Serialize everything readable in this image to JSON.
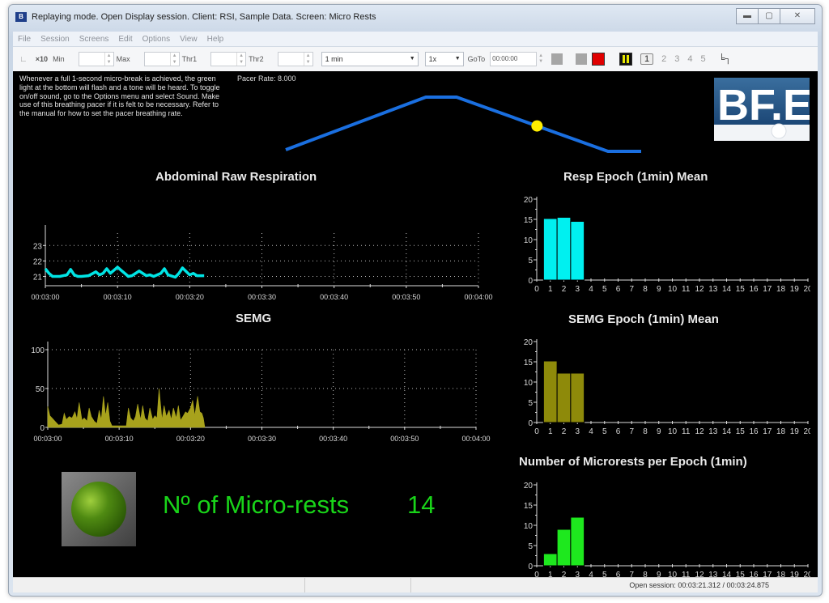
{
  "window": {
    "title": "Replaying mode. Open Display session. Client: RSI, Sample Data. Screen: Micro Rests",
    "controls": [
      "minimize",
      "maximize",
      "close"
    ]
  },
  "menu": [
    "File",
    "Session",
    "Screens",
    "Edit",
    "Options",
    "View",
    "Help"
  ],
  "toolbar": {
    "scale_label": "×10",
    "min_label": "Min",
    "min_value": "",
    "max_label": "Max",
    "max_value": "",
    "thr1_label": "Thr1",
    "thr1_value": "",
    "thr2_label": "Thr2",
    "thr2_value": "",
    "epoch_select": "1 min",
    "speed_select": "1x",
    "goto_label": "GoTo",
    "goto_value": "00:00:00",
    "pages": [
      "1",
      "2",
      "3",
      "4",
      "5"
    ],
    "active_page": "1",
    "colors": {
      "gray": "#a6a6a6",
      "stop": "#e00000",
      "pause": "#e8e800"
    }
  },
  "info_text": "Whenever a full 1-second micro-break is achieved, the green light at the bottom will flash and a tone will be heard. To toggle on/off sound, go to the Options menu and select Sound. Make use of this breathing pacer if it is felt to be necessary. Refer to the manual for how to set the pacer breathing rate.",
  "pacer": {
    "label": "Pacer Rate: 8.000",
    "line_color": "#1a6fe0",
    "marker_color": "#ffee00",
    "progress": 0.71
  },
  "logo": {
    "text": "BF.E"
  },
  "microrests": {
    "label": "Nº of Micro-rests",
    "count": "14",
    "color": "#19d419"
  },
  "status": {
    "session": "Open session: 00:03:21.312 / 00:03:24.875"
  },
  "chart_data": [
    {
      "id": "respiration",
      "type": "line",
      "title": "Abdominal Raw Respiration",
      "color": "#00e5e5",
      "ylim": [
        20.4,
        23.8
      ],
      "yticks": [
        21,
        22,
        23
      ],
      "xlim": [
        180,
        240
      ],
      "xticks": [
        "00:03:00",
        "00:03:10",
        "00:03:20",
        "00:03:30",
        "00:03:40",
        "00:03:50",
        "00:04:00"
      ],
      "grid": true,
      "x": [
        180,
        180.5,
        181,
        182,
        183,
        183.5,
        184,
        184.5,
        185,
        186,
        187,
        187.5,
        188,
        188.5,
        189,
        189.5,
        190,
        190.5,
        191,
        191.5,
        192,
        193,
        194,
        194.5,
        195,
        196,
        196.5,
        197,
        198,
        198.5,
        199,
        200,
        200.5,
        201,
        201.5,
        202
      ],
      "y": [
        21.5,
        21.2,
        21.0,
        21.0,
        21.1,
        21.45,
        21.1,
        21.0,
        21.0,
        21.05,
        21.3,
        21.1,
        21.2,
        21.5,
        21.2,
        21.4,
        21.6,
        21.4,
        21.2,
        21.0,
        21.05,
        21.35,
        21.05,
        21.1,
        21.0,
        21.2,
        21.5,
        21.1,
        20.95,
        21.2,
        21.55,
        21.1,
        21.2,
        21.05,
        21.05,
        21.05
      ]
    },
    {
      "id": "semg",
      "type": "area",
      "title": "SEMG",
      "color": "#a8a21c",
      "ylim": [
        0,
        100
      ],
      "yticks": [
        0,
        50,
        100
      ],
      "xlim": [
        180,
        240
      ],
      "xticks": [
        "00:03:00",
        "00:03:10",
        "00:03:20",
        "00:03:30",
        "00:03:40",
        "00:03:50",
        "00:04:00"
      ],
      "grid": true,
      "x": [
        180,
        180.3,
        180.6,
        181,
        181.5,
        182,
        182.3,
        182.6,
        183,
        183.4,
        183.8,
        184.1,
        184.4,
        184.8,
        185.1,
        185.5,
        185.8,
        186.1,
        186.5,
        186.9,
        187.2,
        187.5,
        187.8,
        188.1,
        188.4,
        188.7,
        189,
        189.5,
        190,
        190.5,
        191,
        191.3,
        191.6,
        192,
        192.3,
        192.6,
        193,
        193.3,
        193.6,
        194,
        194.3,
        194.7,
        195,
        195.3,
        195.6,
        196,
        196.3,
        196.6,
        197,
        197.3,
        197.6,
        198,
        198.3,
        198.6,
        199,
        199.3,
        199.6,
        200,
        200.3,
        200.6,
        201,
        201.3,
        201.6,
        201.8,
        202
      ],
      "y": [
        27,
        15,
        12,
        8,
        3,
        4,
        18,
        10,
        14,
        12,
        20,
        11,
        32,
        9,
        12,
        8,
        25,
        14,
        8,
        5,
        22,
        10,
        40,
        15,
        32,
        8,
        2,
        2,
        2,
        2,
        2,
        25,
        12,
        8,
        14,
        30,
        10,
        28,
        12,
        8,
        25,
        10,
        15,
        12,
        50,
        10,
        28,
        14,
        22,
        10,
        25,
        12,
        28,
        9,
        15,
        20,
        18,
        25,
        35,
        15,
        40,
        20,
        18,
        12,
        0
      ]
    },
    {
      "id": "resp-epoch",
      "type": "bar",
      "title": "Resp Epoch (1min) Mean",
      "color": "#00f0f0",
      "categories": [
        "1",
        "2",
        "3"
      ],
      "values": [
        15.2,
        15.5,
        14.5
      ],
      "ylim": [
        0,
        20
      ],
      "yticks": [
        0,
        5,
        10,
        15,
        20
      ],
      "xlim": [
        0,
        20
      ],
      "xticks": [
        "0",
        "1",
        "2",
        "3",
        "4",
        "5",
        "6",
        "7",
        "8",
        "9",
        "10",
        "11",
        "12",
        "13",
        "14",
        "15",
        "16",
        "17",
        "18",
        "19",
        "20"
      ]
    },
    {
      "id": "semg-epoch",
      "type": "bar",
      "title": "SEMG Epoch (1min) Mean",
      "color": "#8e8a0a",
      "categories": [
        "1",
        "2",
        "3"
      ],
      "values": [
        15.2,
        12.2,
        12.2
      ],
      "ylim": [
        0,
        20
      ],
      "yticks": [
        0,
        5,
        10,
        15,
        20
      ],
      "xlim": [
        0,
        20
      ],
      "xticks": [
        "0",
        "1",
        "2",
        "3",
        "4",
        "5",
        "6",
        "7",
        "8",
        "9",
        "10",
        "11",
        "12",
        "13",
        "14",
        "15",
        "16",
        "17",
        "18",
        "19",
        "20"
      ]
    },
    {
      "id": "microrests-epoch",
      "type": "bar",
      "title": "Number of Microrests per Epoch (1min)",
      "color": "#1ee81e",
      "categories": [
        "1",
        "2",
        "3"
      ],
      "values": [
        3,
        9,
        12
      ],
      "ylim": [
        0,
        20
      ],
      "yticks": [
        0,
        5,
        10,
        15,
        20
      ],
      "xlim": [
        0,
        20
      ],
      "xticks": [
        "0",
        "1",
        "2",
        "3",
        "4",
        "5",
        "6",
        "7",
        "8",
        "9",
        "10",
        "11",
        "12",
        "13",
        "14",
        "15",
        "16",
        "17",
        "18",
        "19",
        "20"
      ]
    }
  ]
}
